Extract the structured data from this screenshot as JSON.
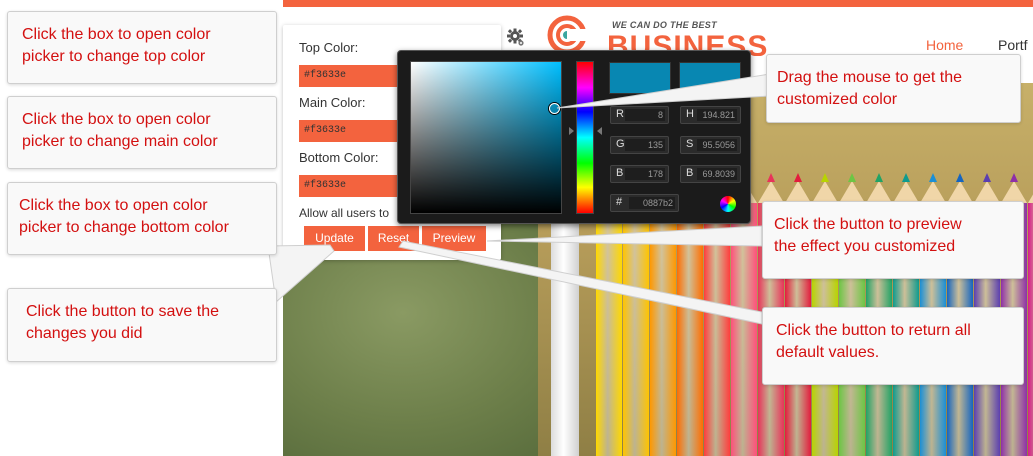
{
  "colors": {
    "accent": "#f3633e",
    "picker_color": "#0887b2",
    "callout_text": "#d31010"
  },
  "site": {
    "tagline": "WE CAN DO THE BEST",
    "brand": "BUSINESS",
    "nav": {
      "home": "Home",
      "portfolio": "Portf"
    }
  },
  "panel": {
    "gear_icon": "gear-icon",
    "top_label": "Top Color:",
    "top_value": "#f3633e",
    "main_label": "Main Color:",
    "main_value": "#f3633e",
    "bottom_label": "Bottom Color:",
    "bottom_value": "#f3633e",
    "allow_text": "Allow all users to",
    "buttons": {
      "update": "Update",
      "reset": "Reset",
      "preview": "Preview"
    }
  },
  "picker": {
    "r_label": "R",
    "r_value": "8",
    "g_label": "G",
    "g_value": "135",
    "b_label": "B",
    "b_value": "178",
    "h_label": "H",
    "h_value": "194.821",
    "s_label": "S",
    "s_value": "95.5056",
    "bv_label": "B",
    "bv_value": "69.8039",
    "hex_label": "#",
    "hex_value": "0887b2"
  },
  "callouts": {
    "top": [
      "Click the box to open color",
      "picker to change top color"
    ],
    "main": [
      "Click the box to open color",
      "picker to change main color"
    ],
    "bottom": [
      "Click the box to open color",
      "picker to change bottom color"
    ],
    "save": [
      "Click the button to save the",
      "changes you did"
    ],
    "drag": [
      "Drag the mouse to get the",
      "customized color"
    ],
    "preview": [
      "Click the button to preview",
      "the effect you customized"
    ],
    "reset": [
      "Click the button to return all",
      "default values."
    ]
  }
}
